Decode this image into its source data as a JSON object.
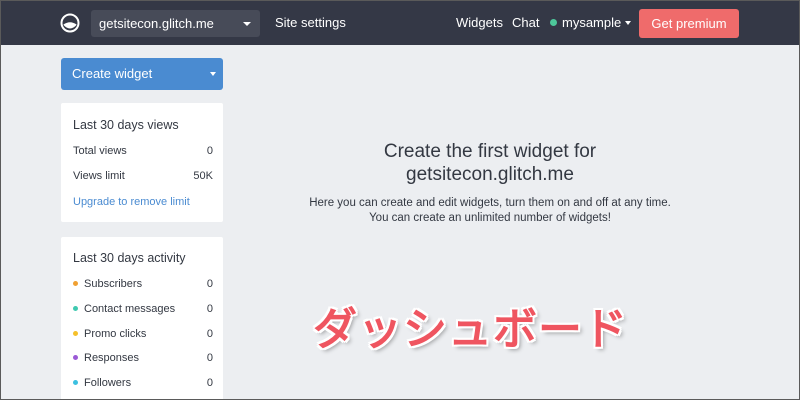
{
  "nav": {
    "site": "getsitecon.glitch.me",
    "site_settings": "Site settings",
    "widgets": "Widgets",
    "chat": "Chat",
    "user": "mysample",
    "user_status_color": "#4dc79a",
    "premium": "Get premium",
    "premium_color": "#ef6b6b"
  },
  "sidebar": {
    "create_widget": "Create widget",
    "views_card": {
      "title": "Last 30 days views",
      "rows": [
        {
          "label": "Total views",
          "value": "0"
        },
        {
          "label": "Views limit",
          "value": "50K"
        }
      ],
      "link": "Upgrade to remove limit"
    },
    "activity_card": {
      "title": "Last 30 days activity",
      "rows": [
        {
          "label": "Subscribers",
          "value": "0",
          "color": "#f0a032"
        },
        {
          "label": "Contact messages",
          "value": "0",
          "color": "#3fc9b0"
        },
        {
          "label": "Promo clicks",
          "value": "0",
          "color": "#f5c02a"
        },
        {
          "label": "Responses",
          "value": "0",
          "color": "#9b5ad6"
        },
        {
          "label": "Followers",
          "value": "0",
          "color": "#3cc0e0"
        }
      ]
    }
  },
  "main": {
    "title_line1": "Create the first widget for",
    "title_line2": "getsitecon.glitch.me",
    "desc_line1": "Here you can create and edit widgets, turn them on and off at any time.",
    "desc_line2": "You can create an unlimited number of widgets!"
  },
  "overlay": {
    "text": "ダッシュボード",
    "color": "#ef5560"
  },
  "icons": {
    "logo": "logo-icon"
  }
}
